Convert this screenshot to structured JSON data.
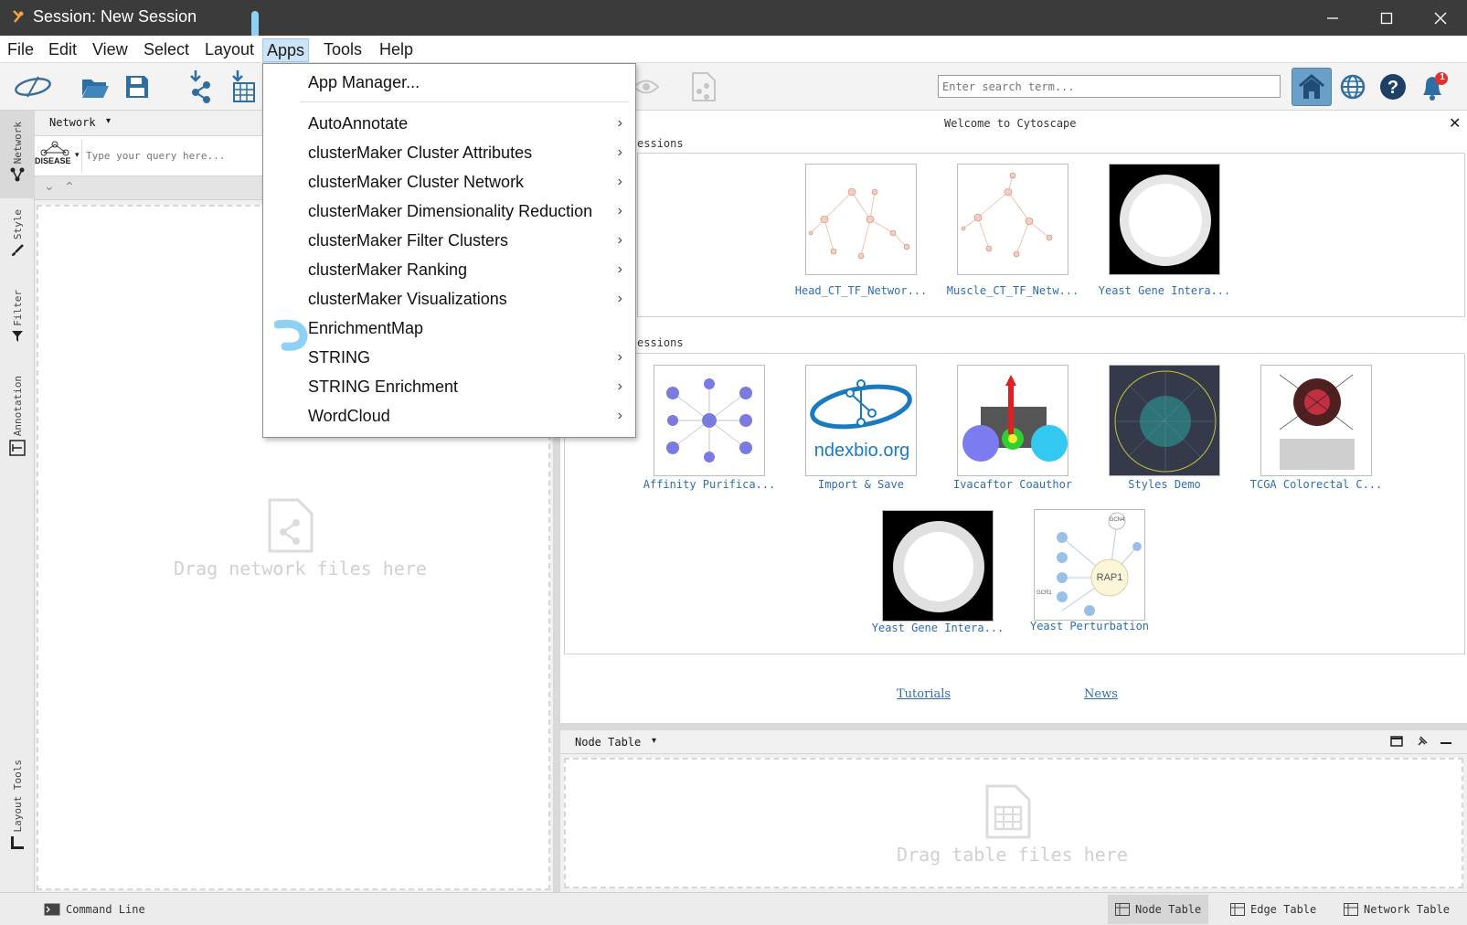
{
  "window": {
    "title": "Session: New Session"
  },
  "menubar": {
    "items": [
      "File",
      "Edit",
      "View",
      "Select",
      "Layout",
      "Apps",
      "Tools",
      "Help"
    ],
    "active": "Apps"
  },
  "apps_menu": {
    "app_manager": "App Manager...",
    "items": [
      {
        "label": "AutoAnnotate",
        "submenu": true
      },
      {
        "label": "clusterMaker Cluster Attributes",
        "submenu": true
      },
      {
        "label": "clusterMaker Cluster Network",
        "submenu": true
      },
      {
        "label": "clusterMaker Dimensionality Reduction",
        "submenu": true
      },
      {
        "label": "clusterMaker Filter Clusters",
        "submenu": true
      },
      {
        "label": "clusterMaker Ranking",
        "submenu": true
      },
      {
        "label": "clusterMaker Visualizations",
        "submenu": true
      },
      {
        "label": "EnrichmentMap",
        "submenu": false
      },
      {
        "label": "STRING",
        "submenu": true
      },
      {
        "label": "STRING Enrichment",
        "submenu": true
      },
      {
        "label": "WordCloud",
        "submenu": true
      }
    ]
  },
  "toolbar": {
    "search_placeholder": "Enter search term...",
    "notification_count": "1"
  },
  "left_tabs": [
    "Network",
    "Style",
    "Filter",
    "Annotation",
    "Layout Tools"
  ],
  "network_panel": {
    "header": "Network",
    "query_placeholder": "Type your query here...",
    "disease_label": "DISEASE",
    "drop_text": "Drag network files here"
  },
  "welcome": {
    "title": "Welcome to Cytoscape",
    "recent_label": "essions",
    "sample_label": "essions",
    "recent_sessions": [
      "Head_CT_TF_Networ...",
      "Muscle_CT_TF_Netw...",
      "Yeast Gene Intera..."
    ],
    "sample_sessions": [
      "Affinity Purifica...",
      "Import & Save",
      "Ivacaftor Coauthor",
      "Styles Demo",
      "TCGA Colorectal C...",
      "Yeast Gene Intera...",
      "Yeast Perturbation"
    ],
    "ndex_text": "ndexbio.org",
    "rap1_text": "RAP1",
    "gcn4_text": "GCN4",
    "gcr1_text": "GCR1",
    "links": [
      "Tutorials",
      "News"
    ]
  },
  "node_table": {
    "header": "Node Table",
    "drop_text": "Drag table files here"
  },
  "statusbar": {
    "command_line": "Command Line",
    "tabs": [
      "Node Table",
      "Edge Table",
      "Network Table"
    ]
  },
  "colors": {
    "titlebar": "#3b3b3b",
    "link": "#2d6db0",
    "menu_active": "#cce4f7",
    "home_button": "#6aa0c8",
    "notification": "#e03030",
    "cursor": "#8fd0f5"
  }
}
